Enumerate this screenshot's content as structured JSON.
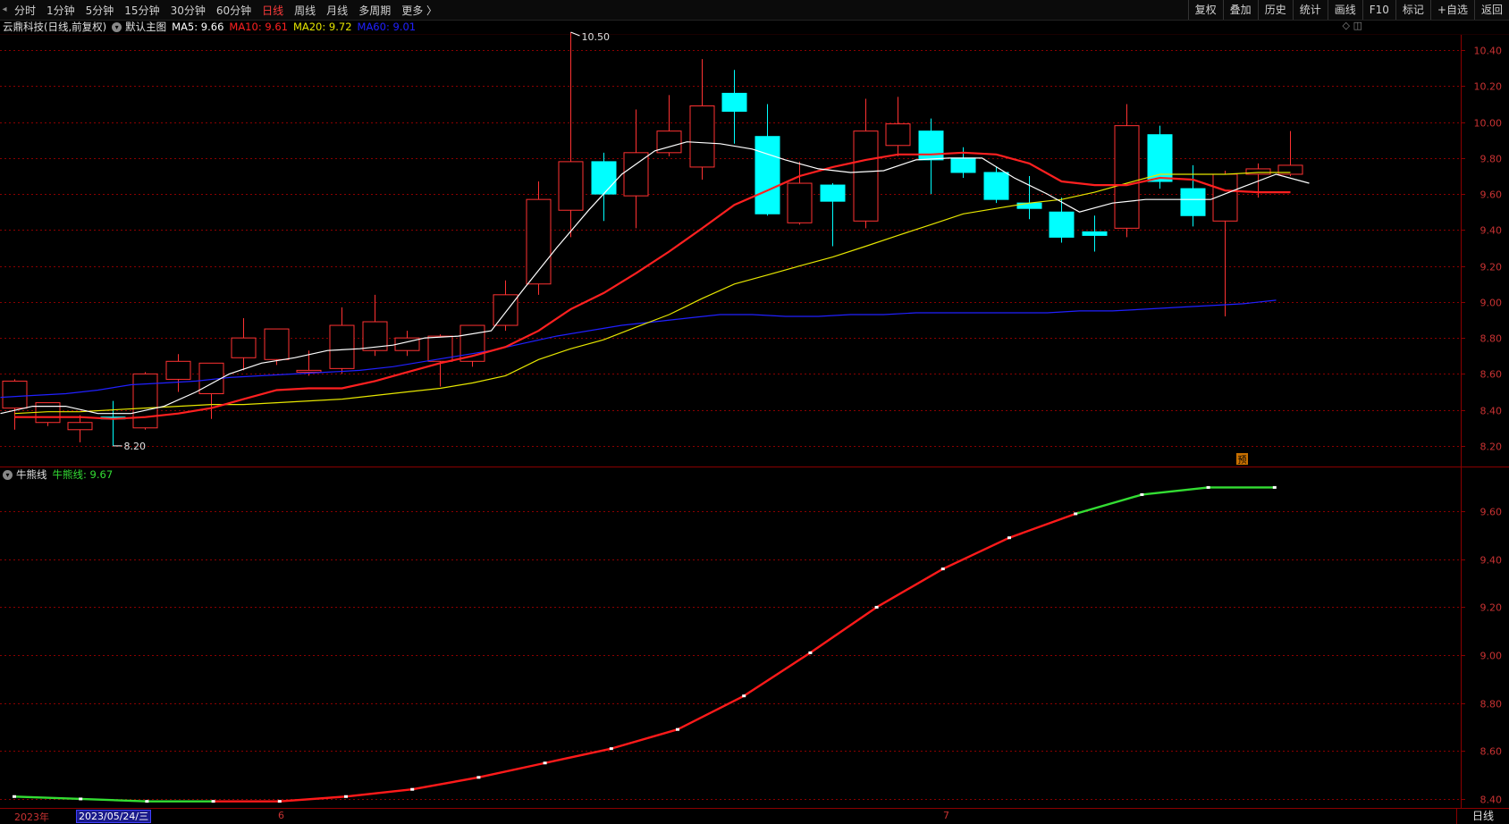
{
  "toolbar": {
    "periods": [
      "分时",
      "1分钟",
      "5分钟",
      "15分钟",
      "30分钟",
      "60分钟",
      "日线",
      "周线",
      "月线",
      "多周期",
      "更多 〉"
    ],
    "active_period": "日线",
    "actions": [
      "复权",
      "叠加",
      "历史",
      "统计",
      "画线",
      "F10",
      "标记",
      "+自选",
      "返回"
    ]
  },
  "main_info": {
    "title": "云鼎科技(日线,前复权)",
    "template": "默认主图",
    "ma5": "MA5: 9.66",
    "ma10": "MA10: 9.61",
    "ma20": "MA20: 9.72",
    "ma60": "MA60: 9.01"
  },
  "sub_info": {
    "name": "牛熊线",
    "value": "牛熊线: 9.67"
  },
  "colors": {
    "up": "#ff3232",
    "down": "#00ffff",
    "ma5": "#ffffff",
    "ma10": "#ff2020",
    "ma20": "#e6e600",
    "ma60": "#2020ff",
    "grid": "#8a0000",
    "axis_text": "#c83232",
    "bull_green": "#33dd33"
  },
  "main_axis": {
    "ticks": [
      "10.40",
      "10.20",
      "10.00",
      "9.80",
      "9.60",
      "9.40",
      "9.20",
      "9.00",
      "8.80",
      "8.60",
      "8.40",
      "8.20"
    ]
  },
  "sub_axis": {
    "ticks": [
      "9.60",
      "9.40",
      "9.20",
      "9.00",
      "8.80",
      "8.60",
      "8.40"
    ]
  },
  "annotations": {
    "high": "10.50",
    "low": "8.20",
    "pre_marker": "预"
  },
  "date_axis": {
    "year": "2023年",
    "cursor_date": "2023/05/24/三",
    "month6": "6",
    "month7": "7",
    "period": "日线"
  },
  "chart_data": [
    {
      "type": "candlestick",
      "y_range": [
        8.12,
        10.48
      ],
      "candles": [
        {
          "o": 8.41,
          "h": 8.57,
          "l": 8.29,
          "c": 8.56
        },
        {
          "o": 8.33,
          "h": 8.44,
          "l": 8.31,
          "c": 8.44
        },
        {
          "o": 8.29,
          "h": 8.37,
          "l": 8.22,
          "c": 8.33
        },
        {
          "o": 8.36,
          "h": 8.45,
          "l": 8.2,
          "c": 8.35
        },
        {
          "o": 8.3,
          "h": 8.61,
          "l": 8.29,
          "c": 8.6
        },
        {
          "o": 8.57,
          "h": 8.71,
          "l": 8.5,
          "c": 8.67
        },
        {
          "o": 8.49,
          "h": 8.66,
          "l": 8.35,
          "c": 8.66
        },
        {
          "o": 8.69,
          "h": 8.91,
          "l": 8.62,
          "c": 8.8
        },
        {
          "o": 8.68,
          "h": 8.85,
          "l": 8.65,
          "c": 8.85
        },
        {
          "o": 8.61,
          "h": 8.73,
          "l": 8.59,
          "c": 8.62
        },
        {
          "o": 8.63,
          "h": 8.97,
          "l": 8.6,
          "c": 8.87
        },
        {
          "o": 8.73,
          "h": 9.04,
          "l": 8.7,
          "c": 8.89
        },
        {
          "o": 8.73,
          "h": 8.84,
          "l": 8.7,
          "c": 8.8
        },
        {
          "o": 8.67,
          "h": 8.82,
          "l": 8.53,
          "c": 8.81
        },
        {
          "o": 8.67,
          "h": 8.87,
          "l": 8.64,
          "c": 8.87
        },
        {
          "o": 8.87,
          "h": 9.12,
          "l": 8.84,
          "c": 9.04
        },
        {
          "o": 9.1,
          "h": 9.67,
          "l": 9.04,
          "c": 9.57
        },
        {
          "o": 9.51,
          "h": 10.5,
          "l": 9.36,
          "c": 9.78
        },
        {
          "o": 9.78,
          "h": 9.83,
          "l": 9.45,
          "c": 9.6
        },
        {
          "o": 9.59,
          "h": 10.07,
          "l": 9.41,
          "c": 9.83
        },
        {
          "o": 9.83,
          "h": 10.15,
          "l": 9.81,
          "c": 9.95
        },
        {
          "o": 9.75,
          "h": 10.35,
          "l": 9.68,
          "c": 10.09
        },
        {
          "o": 10.16,
          "h": 10.29,
          "l": 9.88,
          "c": 10.06
        },
        {
          "o": 9.92,
          "h": 10.1,
          "l": 9.48,
          "c": 9.49
        },
        {
          "o": 9.44,
          "h": 9.78,
          "l": 9.43,
          "c": 9.66
        },
        {
          "o": 9.65,
          "h": 9.66,
          "l": 9.31,
          "c": 9.56
        },
        {
          "o": 9.45,
          "h": 10.13,
          "l": 9.41,
          "c": 9.95
        },
        {
          "o": 9.87,
          "h": 10.14,
          "l": 9.81,
          "c": 9.99
        },
        {
          "o": 9.95,
          "h": 10.02,
          "l": 9.6,
          "c": 9.79
        },
        {
          "o": 9.8,
          "h": 9.86,
          "l": 9.69,
          "c": 9.72
        },
        {
          "o": 9.72,
          "h": 9.75,
          "l": 9.55,
          "c": 9.57
        },
        {
          "o": 9.55,
          "h": 9.7,
          "l": 9.46,
          "c": 9.52
        },
        {
          "o": 9.5,
          "h": 9.58,
          "l": 9.33,
          "c": 9.36
        },
        {
          "o": 9.39,
          "h": 9.48,
          "l": 9.28,
          "c": 9.37
        },
        {
          "o": 9.41,
          "h": 10.1,
          "l": 9.36,
          "c": 9.98
        },
        {
          "o": 9.93,
          "h": 9.98,
          "l": 9.63,
          "c": 9.67
        },
        {
          "o": 9.63,
          "h": 9.76,
          "l": 9.42,
          "c": 9.48
        },
        {
          "o": 9.45,
          "h": 9.73,
          "l": 8.92,
          "c": 9.71
        },
        {
          "o": 9.71,
          "h": 9.77,
          "l": 9.58,
          "c": 9.74
        },
        {
          "o": 9.71,
          "h": 9.95,
          "l": 9.7,
          "c": 9.76
        }
      ],
      "ma5": [
        8.38,
        8.42,
        8.42,
        8.38,
        8.38,
        8.42,
        8.5,
        8.6,
        8.66,
        8.69,
        8.73,
        8.74,
        8.76,
        8.8,
        8.81,
        8.84,
        9.07,
        9.3,
        9.51,
        9.71,
        9.84,
        9.89,
        9.88,
        9.85,
        9.79,
        9.74,
        9.72,
        9.73,
        9.79,
        9.8,
        9.8,
        9.69,
        9.6,
        9.5,
        9.55,
        9.57,
        9.57,
        9.57,
        9.64,
        9.71,
        9.66
      ],
      "ma10": [
        8.36,
        8.36,
        8.36,
        8.35,
        8.36,
        8.38,
        8.41,
        8.46,
        8.51,
        8.52,
        8.52,
        8.56,
        8.61,
        8.66,
        8.7,
        8.75,
        8.84,
        8.96,
        9.05,
        9.16,
        9.28,
        9.41,
        9.54,
        9.62,
        9.7,
        9.75,
        9.79,
        9.82,
        9.82,
        9.83,
        9.82,
        9.77,
        9.67,
        9.65,
        9.65,
        9.69,
        9.68,
        9.62,
        9.61,
        9.61
      ],
      "ma20": [
        8.38,
        8.39,
        8.39,
        8.4,
        8.41,
        8.42,
        8.43,
        8.43,
        8.44,
        8.45,
        8.46,
        8.48,
        8.5,
        8.52,
        8.55,
        8.59,
        8.68,
        8.74,
        8.79,
        8.86,
        8.93,
        9.02,
        9.1,
        9.15,
        9.2,
        9.25,
        9.31,
        9.37,
        9.43,
        9.49,
        9.52,
        9.55,
        9.57,
        9.61,
        9.66,
        9.71,
        9.71,
        9.71,
        9.72,
        9.72
      ],
      "ma60": [
        8.47,
        8.48,
        8.49,
        8.51,
        8.54,
        8.55,
        8.56,
        8.58,
        8.59,
        8.6,
        8.61,
        8.62,
        8.64,
        8.67,
        8.7,
        8.73,
        8.77,
        8.81,
        8.84,
        8.87,
        8.89,
        8.91,
        8.93,
        8.93,
        8.92,
        8.92,
        8.93,
        8.93,
        8.94,
        8.94,
        8.94,
        8.94,
        8.94,
        8.95,
        8.95,
        8.96,
        8.97,
        8.98,
        8.99,
        9.01
      ]
    },
    {
      "type": "line",
      "name": "牛熊线",
      "y_range": [
        8.37,
        9.75
      ],
      "x": [
        0,
        1,
        2,
        3,
        4,
        5,
        6,
        7,
        8,
        9,
        10,
        11,
        12,
        13,
        14,
        15,
        16,
        17,
        18,
        19
      ],
      "values": [
        8.41,
        8.4,
        8.39,
        8.39,
        8.39,
        8.41,
        8.44,
        8.49,
        8.55,
        8.61,
        8.69,
        8.83,
        9.01,
        9.2,
        9.36,
        9.49,
        9.59,
        9.67,
        9.7,
        9.7
      ],
      "trend": [
        "down",
        "down",
        "down",
        "down",
        "up",
        "up",
        "up",
        "up",
        "up",
        "up",
        "up",
        "up",
        "up",
        "up",
        "up",
        "up",
        "up",
        "down",
        "down",
        "down"
      ]
    }
  ]
}
